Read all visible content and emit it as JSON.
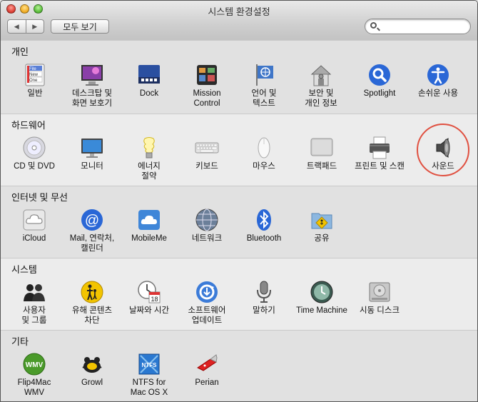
{
  "window": {
    "title": "시스템 환경설정"
  },
  "toolbar": {
    "back": "◀",
    "forward": "▶",
    "show_all": "모두 보기",
    "search_placeholder": ""
  },
  "sections": {
    "personal": {
      "title": "개인",
      "items": [
        "일반",
        "데스크탑 및\n화면 보호기",
        "Dock",
        "Mission\nControl",
        "언어 및\n텍스트",
        "보안 및\n개인 정보",
        "Spotlight",
        "손쉬운 사용"
      ]
    },
    "hardware": {
      "title": "하드웨어",
      "items": [
        "CD 및 DVD",
        "모니터",
        "에너지\n절약",
        "키보드",
        "마우스",
        "트랙패드",
        "프린트 및 스캔",
        "사운드"
      ]
    },
    "internet": {
      "title": "인터넷 및 무선",
      "items": [
        "iCloud",
        "Mail, 연락처,\n캘린더",
        "MobileMe",
        "네트워크",
        "Bluetooth",
        "공유"
      ]
    },
    "system": {
      "title": "시스템",
      "items": [
        "사용자\n및 그룹",
        "유해 콘텐츠\n차단",
        "날짜와 시간",
        "소프트웨어\n업데이트",
        "말하기",
        "Time Machine",
        "시동 디스크"
      ]
    },
    "other": {
      "title": "기타",
      "items": [
        "Flip4Mac\nWMV",
        "Growl",
        "NTFS for\nMac OS X",
        "Perian"
      ]
    }
  },
  "icon_text": {
    "general_file": "File",
    "general_new": "New",
    "general_one": "One",
    "date_day": "18",
    "flip4mac": "WMV",
    "ntfs": "NTFS"
  },
  "accent": "#e05040"
}
